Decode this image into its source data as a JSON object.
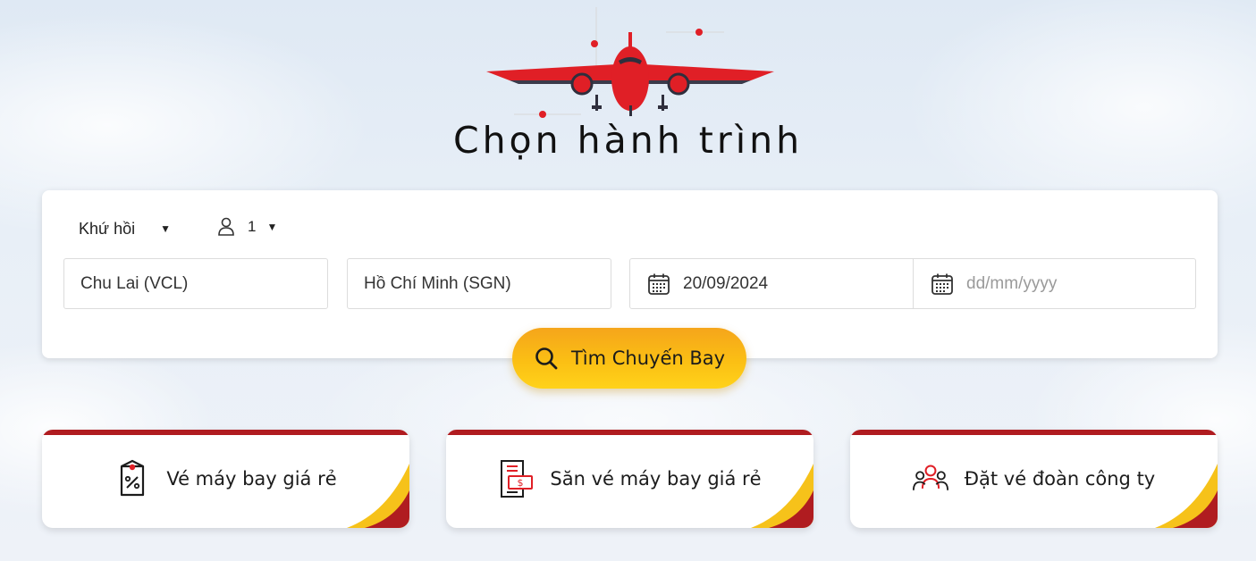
{
  "hero": {
    "title": "Chọn hành trình",
    "icon": "airplane-icon"
  },
  "search": {
    "trip_type": "Khứ hồi",
    "passengers": "1",
    "origin": "Chu Lai (VCL)",
    "destination": "Hồ Chí Minh (SGN)",
    "depart_date": "20/09/2024",
    "return_date_placeholder": "dd/mm/yyyy",
    "submit_label": "Tìm Chuyến Bay"
  },
  "promos": [
    {
      "label": "Vé máy bay giá rẻ",
      "icon": "discount-tag-icon"
    },
    {
      "label": "Săn vé máy bay giá rẻ",
      "icon": "money-receipt-icon"
    },
    {
      "label": "Đặt vé đoàn công ty",
      "icon": "group-people-icon"
    }
  ],
  "colors": {
    "brand_red": "#e01f26",
    "dark_red": "#b01c20",
    "accent_yellow": "#fbbf14"
  }
}
